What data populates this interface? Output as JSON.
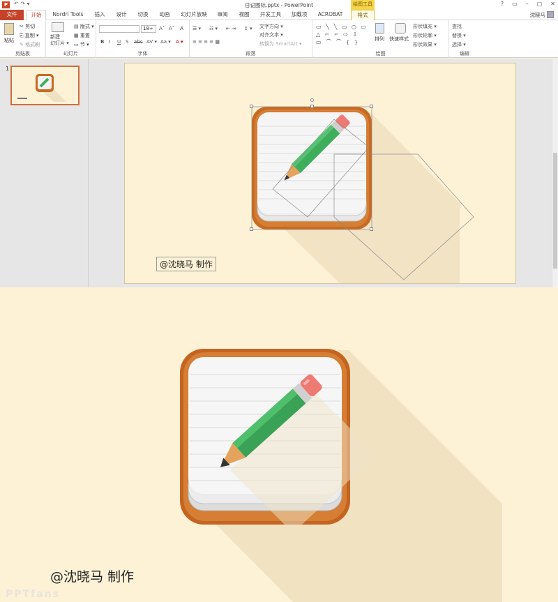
{
  "window": {
    "title": "日记图标.pptx - PowerPoint",
    "app_icon_label": "P",
    "context_tab_group": "绘图工具",
    "user_name": "沈晓马",
    "quick_access": "↶ ↷ ▾",
    "window_buttons": [
      "?",
      "▭",
      "–",
      "▢",
      "✕"
    ]
  },
  "tabs": [
    {
      "label": "文件"
    },
    {
      "label": "开始"
    },
    {
      "label": "Nordri Tools"
    },
    {
      "label": "插入"
    },
    {
      "label": "设计"
    },
    {
      "label": "切换"
    },
    {
      "label": "动画"
    },
    {
      "label": "幻灯片放映"
    },
    {
      "label": "审阅"
    },
    {
      "label": "视图"
    },
    {
      "label": "开发工具"
    },
    {
      "label": "加载项"
    },
    {
      "label": "ACROBAT"
    },
    {
      "label": "格式"
    }
  ],
  "ribbon": {
    "clipboard": {
      "label": "剪贴板",
      "paste": "粘贴",
      "cut": "✂ 剪切",
      "copy": "⎘ 复制 ▾",
      "format_painter": "✎ 格式刷"
    },
    "slides": {
      "label": "幻灯片",
      "new_slide": "新建\n幻灯片 ▾",
      "layout": "▤ 版式 ▾",
      "reset": "▦ 重置",
      "section": "▭ 节 ▾"
    },
    "font": {
      "label": "字体",
      "font_name": "",
      "font_size": "18+",
      "grow": "A˄",
      "shrink": "A˅",
      "clear": "A̸",
      "bold": "B",
      "italic": "I",
      "underline": "U",
      "shadow": "S",
      "strike": "abc",
      "spacing": "AV ▾",
      "case": "Aa ▾",
      "color": "A ▾"
    },
    "paragraph": {
      "label": "段落",
      "bullets": "☰ ▾",
      "numbering": "☷ ▾",
      "indent": "⇤ ⇥",
      "line_spacing": "↕ ▾",
      "align": "≡ ≡ ≡ ≡ ▦",
      "text_direction": "文字方向 ▾",
      "align_text": "对齐文本 ▾",
      "smartart": "转换为 SmartArt ▾"
    },
    "drawing": {
      "label": "绘图",
      "shapes": "▭ ╲ ╲ ▭ ○ ▭ △ ⌐ ⌐ ⇨ ⇩ ▭ ⌒ ⌒ { } ☆",
      "arrange": "排列",
      "quick_styles": "快速样式",
      "fill": "形状填充 ▾",
      "outline": "形状轮廓 ▾",
      "effects": "形状效果 ▾"
    },
    "editing": {
      "label": "编辑",
      "find": "查找",
      "replace": "替换 ▾",
      "select": "选择 ▾"
    }
  },
  "thumbnails": [
    {
      "number": "1"
    }
  ],
  "slide": {
    "credit_text": "@沈晓马  制作"
  },
  "render": {
    "credit_text": "@沈晓马  制作",
    "watermark": "PPTfans"
  },
  "colors": {
    "background": "#fdf1d6",
    "frame": "#c86a22",
    "pencil_green": "#3fae5c",
    "eraser": "#ef7a73",
    "accent_red": "#c5432a"
  }
}
